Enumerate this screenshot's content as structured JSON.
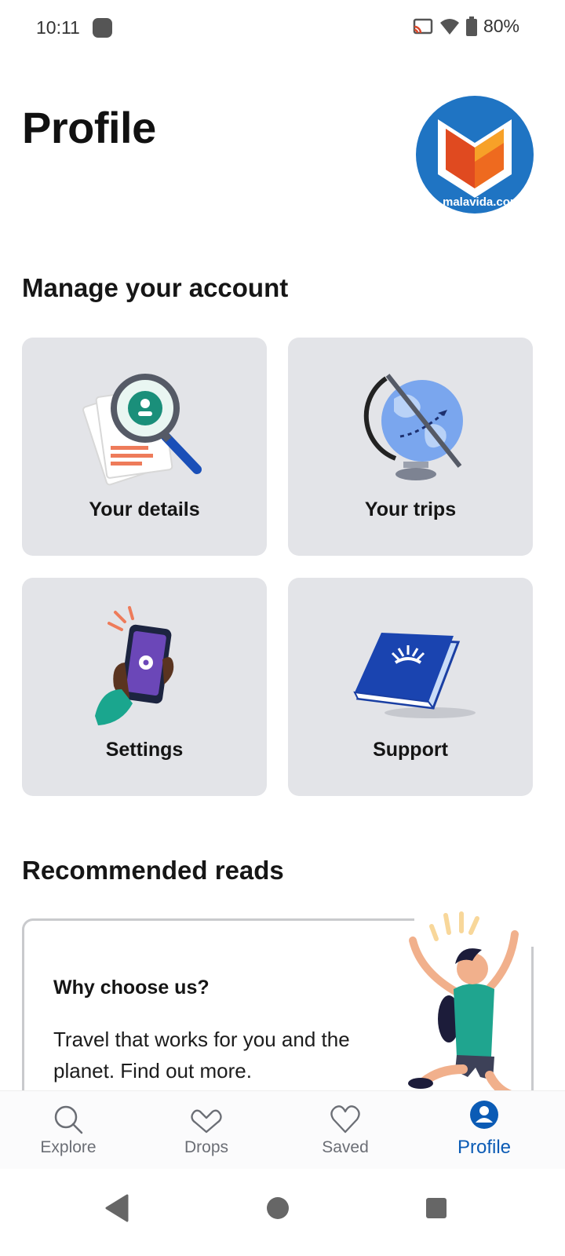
{
  "status_bar": {
    "time": "10:11",
    "battery": "80%"
  },
  "header": {
    "title": "Profile",
    "avatar_caption": "malavida.com"
  },
  "manage": {
    "title": "Manage your account",
    "tiles": [
      {
        "label": "Your details"
      },
      {
        "label": "Your trips"
      },
      {
        "label": "Settings"
      },
      {
        "label": "Support"
      }
    ]
  },
  "reads": {
    "title": "Recommended reads",
    "card": {
      "title": "Why choose us?",
      "text": "Travel that works for you and the planet. Find out more."
    }
  },
  "bottom_nav": {
    "items": [
      {
        "label": "Explore",
        "icon": "search-icon"
      },
      {
        "label": "Drops",
        "icon": "drops-icon"
      },
      {
        "label": "Saved",
        "icon": "heart-icon"
      },
      {
        "label": "Profile",
        "icon": "profile-icon"
      }
    ],
    "active": "Profile"
  },
  "colors": {
    "accent": "#0b5bb5",
    "tile_bg": "#e3e4e8",
    "inactive": "#6b6e75"
  }
}
